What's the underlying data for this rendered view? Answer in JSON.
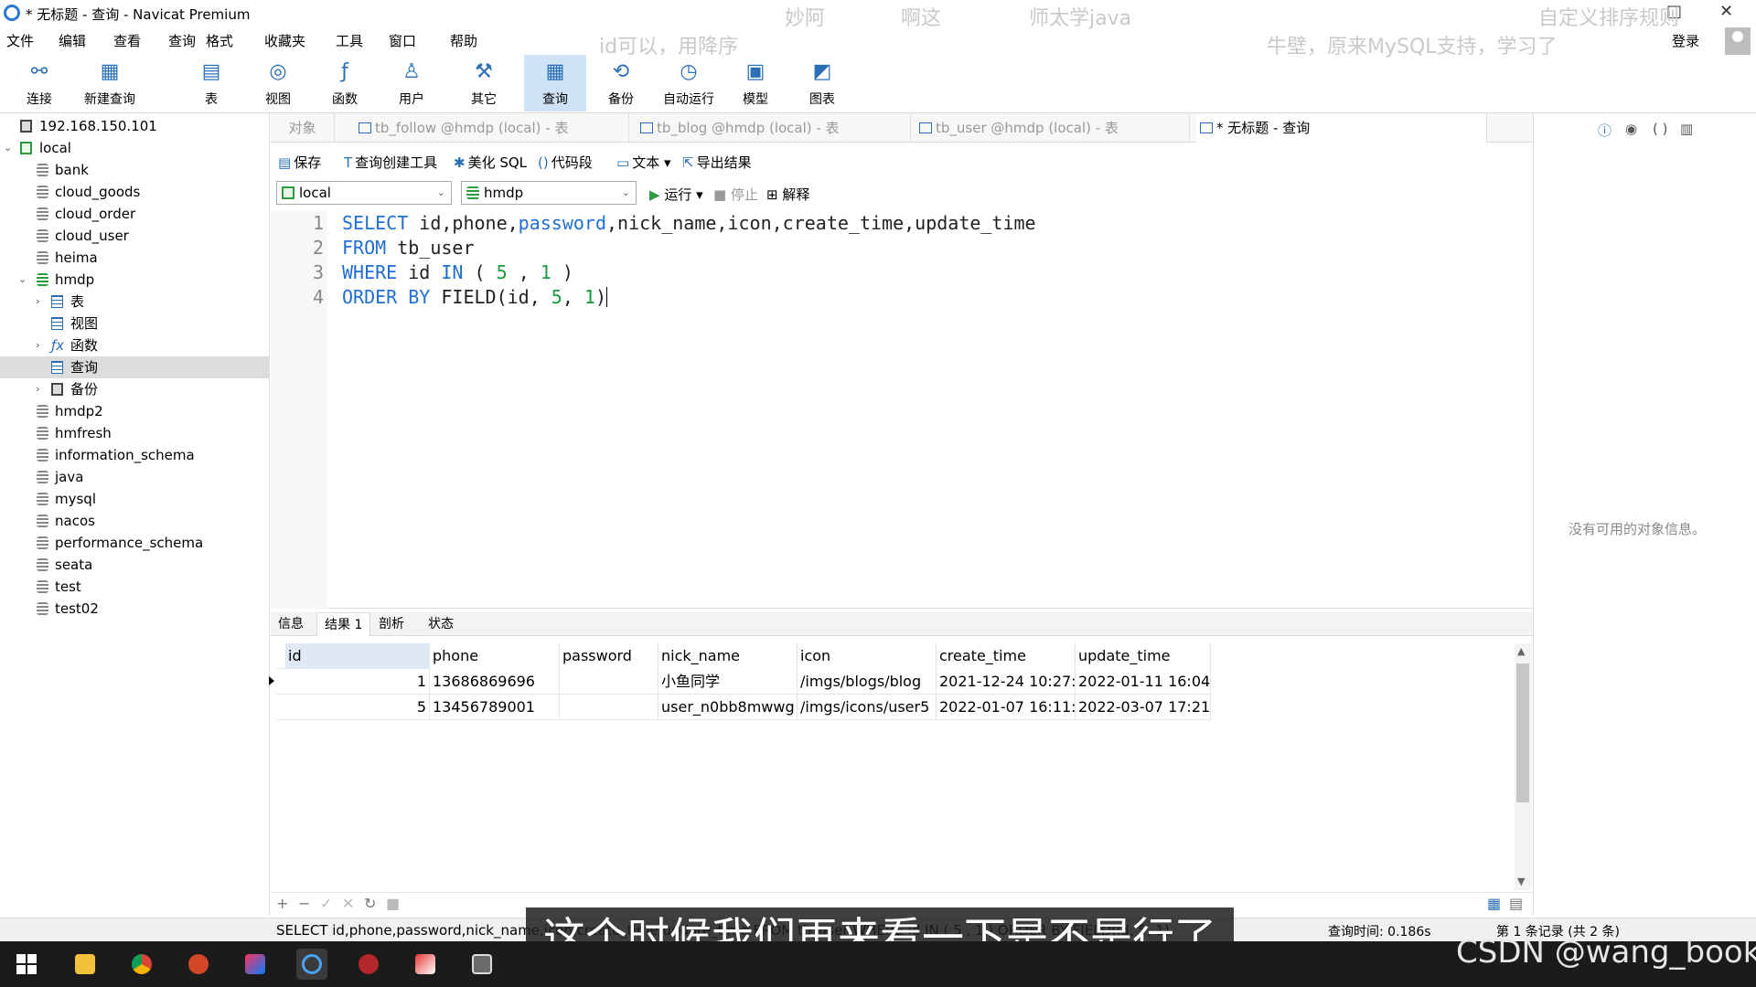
{
  "window": {
    "title": "* 无标题 - 查询 - Navicat Premium",
    "restore_glyph": "□",
    "close_glyph": "✕"
  },
  "overlay_texts": [
    "妙阿",
    "啊这",
    "师太学java",
    "自定义排序规则",
    "id可以，用降序",
    "牛壁，原来MySQL支持，学习了"
  ],
  "menu": [
    "文件",
    "编辑",
    "查看",
    "查询",
    "格式",
    "收藏夹",
    "工具",
    "窗口",
    "帮助"
  ],
  "login_label": "登录",
  "toolbar": [
    {
      "label": "连接",
      "icon": "connect-icon",
      "glyph": "⚯"
    },
    {
      "label": "新建查询",
      "icon": "new-query-icon",
      "glyph": "▦"
    },
    {
      "label": "表",
      "icon": "table-icon",
      "glyph": "▤"
    },
    {
      "label": "视图",
      "icon": "view-icon",
      "glyph": "◎"
    },
    {
      "label": "函数",
      "icon": "function-icon",
      "glyph": "ƒ"
    },
    {
      "label": "用户",
      "icon": "user-icon",
      "glyph": "♙"
    },
    {
      "label": "其它",
      "icon": "tools-icon",
      "glyph": "⚒"
    },
    {
      "label": "查询",
      "icon": "query-icon",
      "glyph": "▦"
    },
    {
      "label": "备份",
      "icon": "backup-icon",
      "glyph": "⟲"
    },
    {
      "label": "自动运行",
      "icon": "autorun-icon",
      "glyph": "◷"
    },
    {
      "label": "模型",
      "icon": "model-icon",
      "glyph": "▣"
    },
    {
      "label": "图表",
      "icon": "chart-icon",
      "glyph": "◩"
    }
  ],
  "tree": [
    {
      "label": "192.168.150.101",
      "icon": "connection-icon"
    },
    {
      "label": "local",
      "icon": "connection-icon",
      "arrow": "⌄"
    },
    {
      "label": "bank",
      "icon": "database-icon"
    },
    {
      "label": "cloud_goods",
      "icon": "database-icon"
    },
    {
      "label": "cloud_order",
      "icon": "database-icon"
    },
    {
      "label": "cloud_user",
      "icon": "database-icon"
    },
    {
      "label": "heima",
      "icon": "database-icon"
    },
    {
      "label": "hmdp",
      "icon": "database-icon",
      "arrow": "⌄"
    },
    {
      "label": "表",
      "icon": "table-icon",
      "arrow": "›"
    },
    {
      "label": "视图",
      "icon": "view-icon"
    },
    {
      "label": "函数",
      "icon": "function-icon",
      "arrow": "›"
    },
    {
      "label": "查询",
      "icon": "query-icon"
    },
    {
      "label": "备份",
      "icon": "backup-icon",
      "arrow": "›"
    },
    {
      "label": "hmdp2",
      "icon": "database-icon"
    },
    {
      "label": "hmfresh",
      "icon": "database-icon"
    },
    {
      "label": "information_schema",
      "icon": "database-icon"
    },
    {
      "label": "java",
      "icon": "database-icon"
    },
    {
      "label": "mysql",
      "icon": "database-icon"
    },
    {
      "label": "nacos",
      "icon": "database-icon"
    },
    {
      "label": "performance_schema",
      "icon": "database-icon"
    },
    {
      "label": "seata",
      "icon": "database-icon"
    },
    {
      "label": "test",
      "icon": "database-icon"
    },
    {
      "label": "test02",
      "icon": "database-icon"
    }
  ],
  "tabs": [
    "对象",
    "tb_follow @hmdp (local) - 表",
    "tb_blog @hmdp (local) - 表",
    "tb_user @hmdp (local) - 表",
    "* 无标题 - 查询"
  ],
  "query_toolbar": {
    "save": "保存",
    "builder": "查询创建工具",
    "beautify": "美化 SQL",
    "snippet": "代码段",
    "text": "文本",
    "export": "导出结果"
  },
  "selectors": {
    "connection": "local",
    "database": "hmdp",
    "run": "运行",
    "stop": "停止",
    "explain": "解释"
  },
  "editor": {
    "line_numbers": [
      "1",
      "2",
      "3",
      "4"
    ]
  },
  "result_tabs": [
    "信息",
    "结果 1",
    "剖析",
    "状态"
  ],
  "results": {
    "columns": [
      "id",
      "phone",
      "password",
      "nick_name",
      "icon",
      "create_time",
      "update_time"
    ],
    "rows": [
      [
        "1",
        "13686869696",
        "",
        "小鱼同学",
        "/imgs/blogs/blog",
        "2021-12-24 10:27:",
        "2022-01-11 16:04:"
      ],
      [
        "5",
        "13456789001",
        "",
        "user_n0bb8mwwg",
        "/imgs/icons/user5",
        "2022-01-07 16:11:",
        "2022-03-07 17:21:"
      ]
    ]
  },
  "info_panel": {
    "empty_text": "没有可用的对象信息。"
  },
  "status": {
    "sql": "SELECT id,phone,password,nick_name,icon,create_time,update_time FROM tb_user WHERE id IN ( 5 , 1 ) ORDER BY FIELD(id, 5, 1)",
    "query_time": "查询时间: 0.186s",
    "records": "第 1 条记录 (共 2 条)"
  },
  "subtitle": "这个时候我们再来看一下是不是行了",
  "watermark": "CSDN @wang_book"
}
